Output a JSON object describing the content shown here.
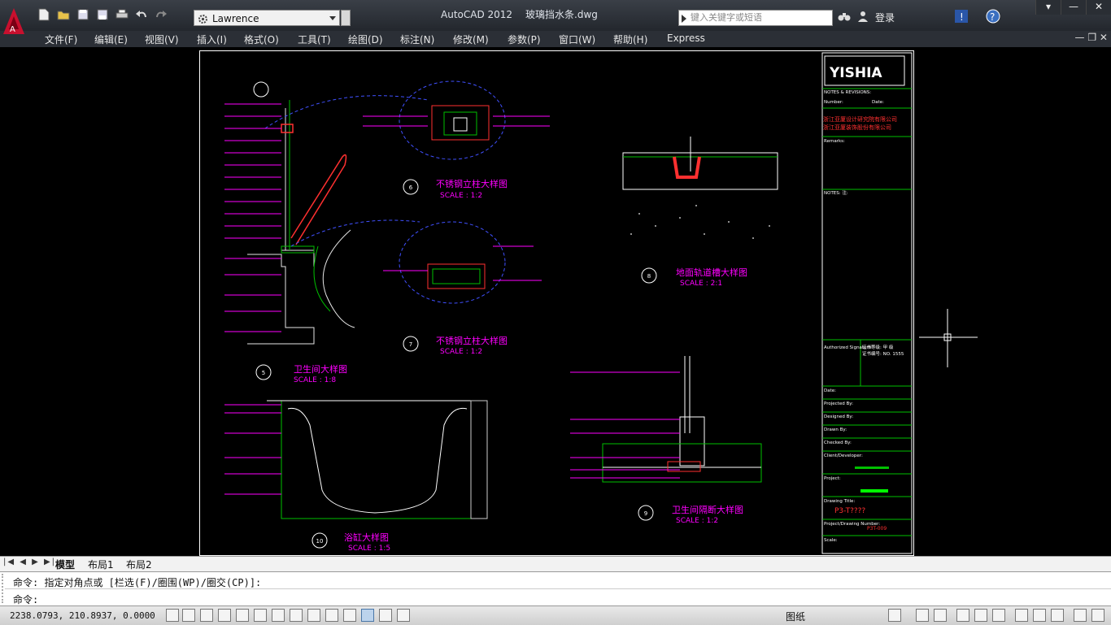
{
  "app": {
    "name": "AutoCAD 2012",
    "file": "玻璃挡水条.dwg"
  },
  "workspace": {
    "value": "Lawrence"
  },
  "search": {
    "placeholder": "键入关键字或短语"
  },
  "login_label": "登录",
  "menu": [
    "文件(F)",
    "编辑(E)",
    "视图(V)",
    "插入(I)",
    "格式(O)",
    "工具(T)",
    "绘图(D)",
    "标注(N)",
    "修改(M)",
    "参数(P)",
    "窗口(W)",
    "帮助(H)",
    "Express"
  ],
  "drawing": {
    "details": [
      {
        "title": "不锈钢立柱大样图",
        "scale": "SCALE    :   1:2",
        "no": "6"
      },
      {
        "title": "不锈钢立柱大样图",
        "scale": "SCALE    :   1:2",
        "no": "7"
      },
      {
        "title": "卫生间大样图",
        "scale": "SCALE    :   1:8",
        "no": "5"
      },
      {
        "title": "地面轨道槽大样图",
        "scale": "SCALE    :   2:1",
        "no": "8"
      },
      {
        "title": "卫生间隔断大样图",
        "scale": "SCALE   :   1:2",
        "no": "9"
      },
      {
        "title": "浴缸大样图",
        "scale": "SCALE   :   1:5",
        "no": "10"
      }
    ],
    "titleblock": {
      "logo": "YISHIA",
      "notes_head": "NOTES & REVISIONS:",
      "number": "Number:",
      "date": "Date:",
      "company1": "浙江亚厦设计研究院有限公司",
      "company2": "浙江亚厦装饰股份有限公司",
      "remarks": "Remarks:",
      "notes": "NOTES: 注:",
      "authorized": "Authorized Signature:",
      "cert1": "证书等级: 甲 级",
      "cert2": "证书编号: NO. 1555",
      "date_row": "Date:",
      "projected": "Projected By:",
      "designed": "Designed By:",
      "drawn": "Drawn By:",
      "checked": "Checked By:",
      "client": "Client/Developer:",
      "project": "Project:",
      "drawing_title": "Drawing Title:",
      "drawing_code": "P3-T????",
      "drawing_number": "Project/Drawing Number:",
      "number_val": "P3T-009",
      "scale": "Scale:"
    }
  },
  "tabs": [
    "模型",
    "布局1",
    "布局2"
  ],
  "command": {
    "history": "命令: 指定对角点或 [栏选(F)/圈围(WP)/圈交(CP)]:",
    "prompt": "命令:"
  },
  "status": {
    "coords": "2238.0793, 210.8937, 0.0000",
    "paper_label": "图纸"
  }
}
